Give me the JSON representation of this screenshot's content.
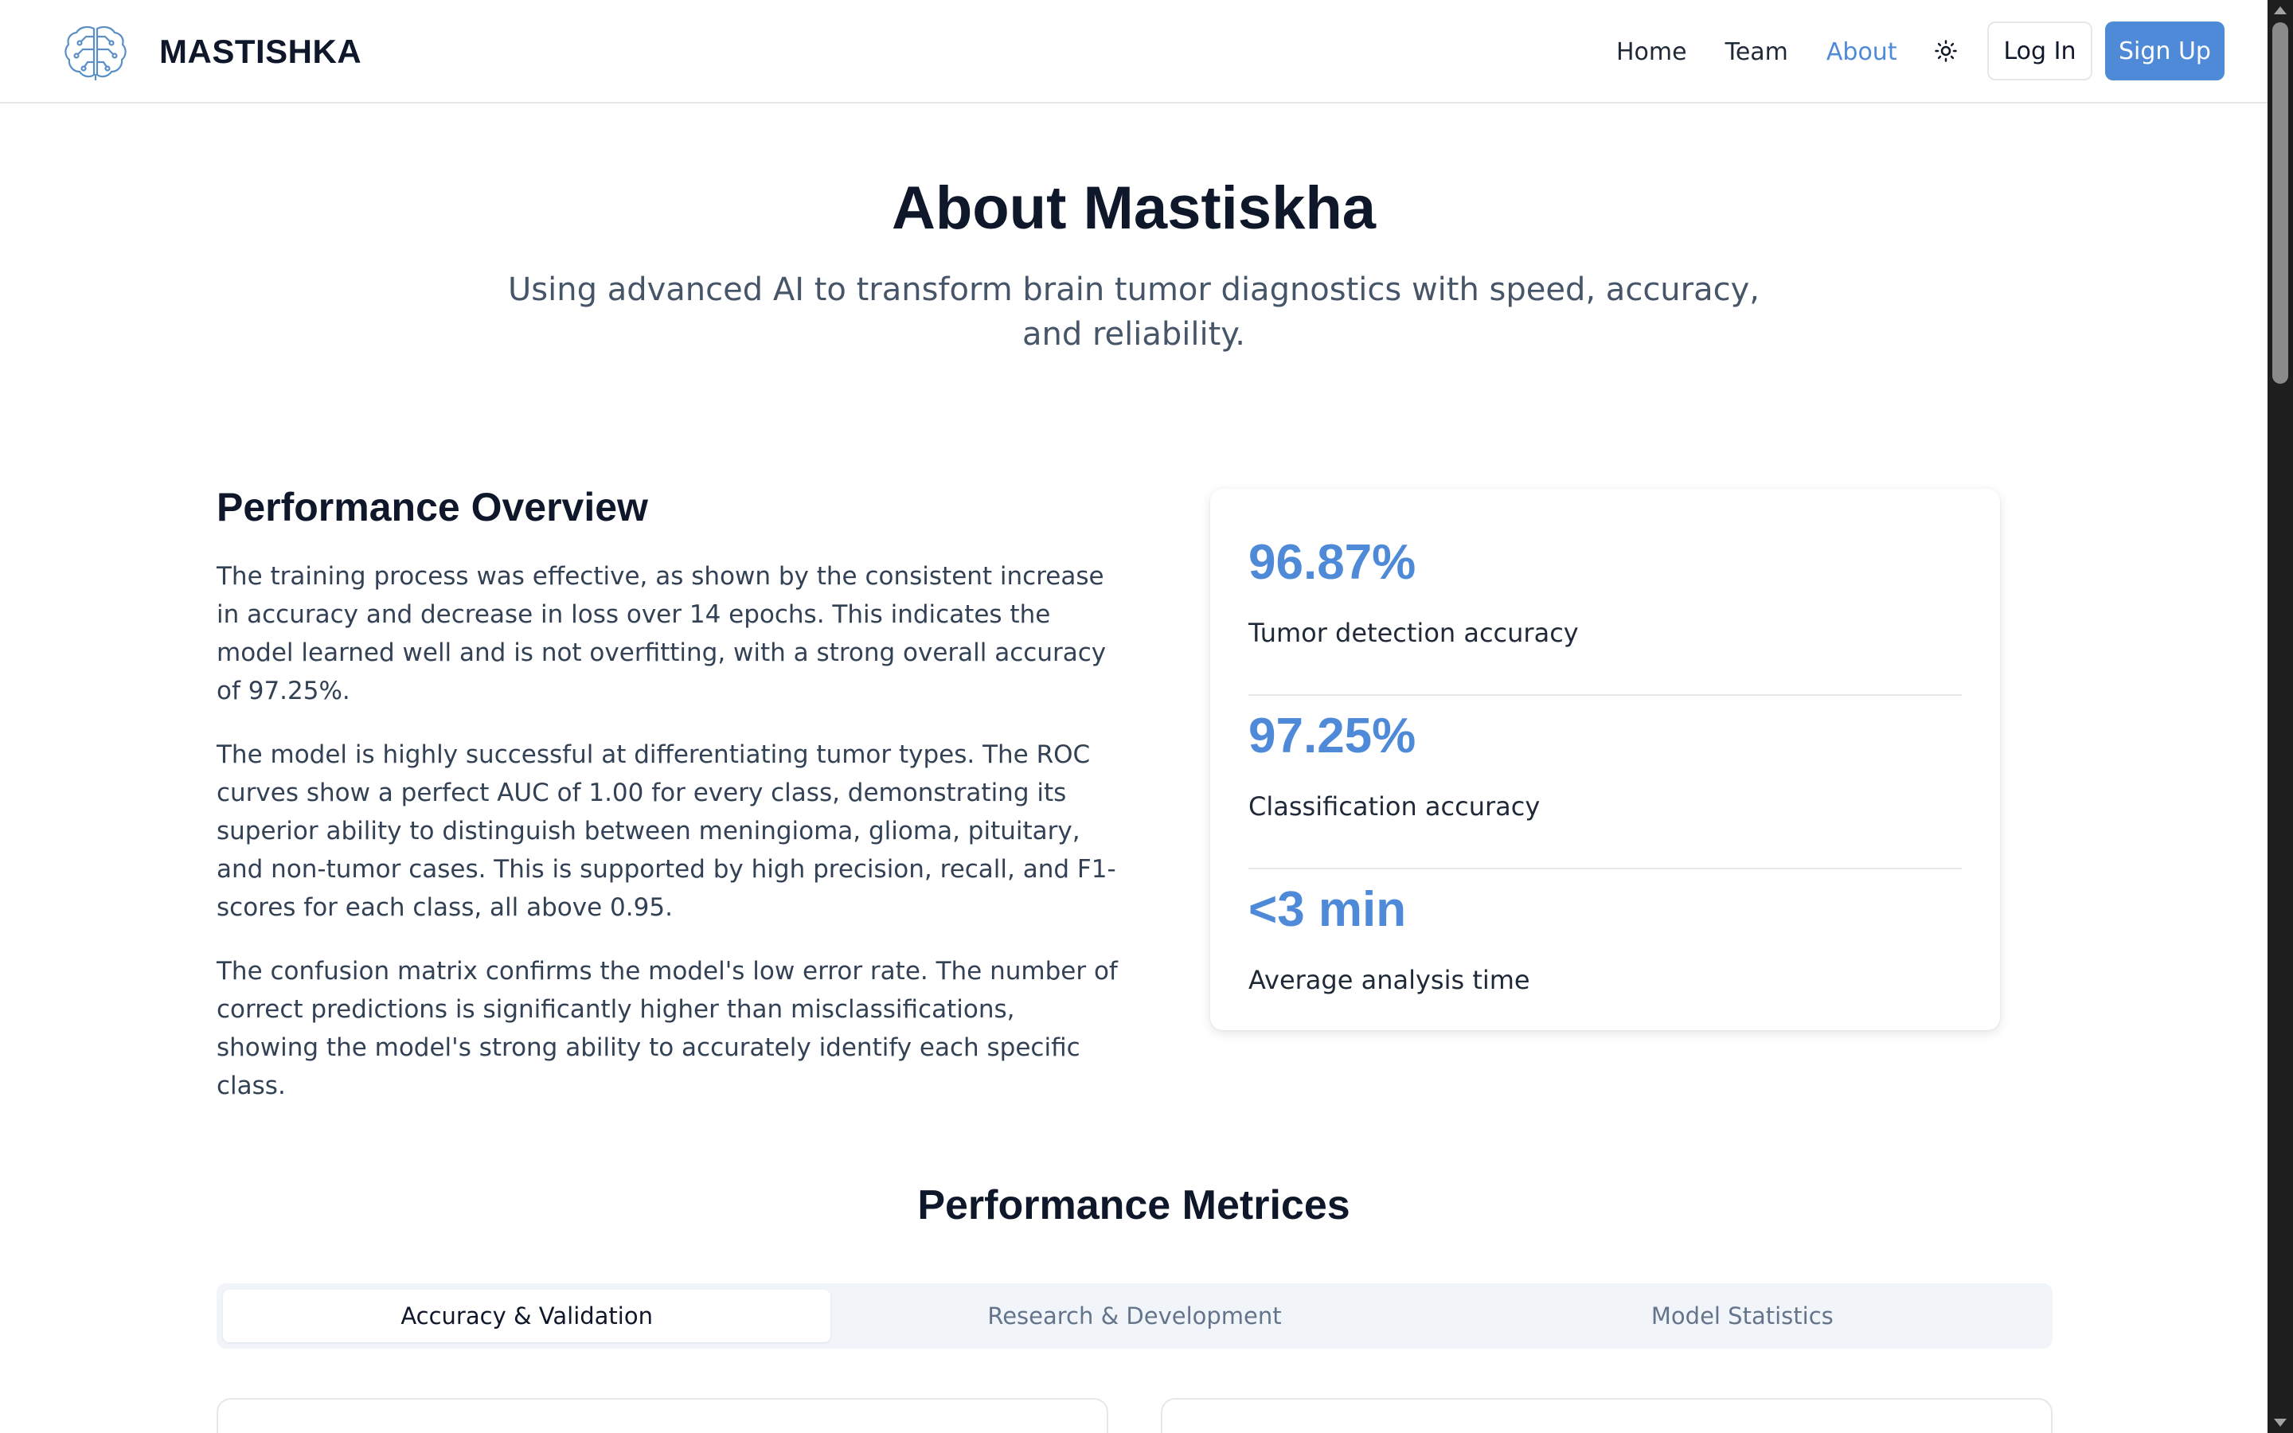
{
  "header": {
    "brand_name": "MASTISHKA",
    "logo_icon": "brain-circuit-icon",
    "nav": [
      {
        "label": "Home",
        "active": false
      },
      {
        "label": "Team",
        "active": false
      },
      {
        "label": "About",
        "active": true
      }
    ],
    "theme_icon": "sun-icon",
    "login_label": "Log In",
    "signup_label": "Sign Up"
  },
  "hero": {
    "title": "About Mastiskha",
    "subtitle": "Using advanced AI to transform brain tumor diagnostics with speed, accuracy, and reliability."
  },
  "overview": {
    "title": "Performance Overview",
    "paragraphs": [
      "The training process was effective, as shown by the consistent increase in accuracy and decrease in loss over 14 epochs. This indicates the model learned well and is not overfitting, with a strong overall accuracy of 97.25%.",
      "The model is highly successful at differentiating tumor types. The ROC curves show a perfect AUC of 1.00 for every class, demonstrating its superior ability to distinguish between meningioma, glioma, pituitary, and non-tumor cases. This is supported by high precision, recall, and F1-scores for each class, all above 0.95.",
      "The confusion matrix confirms the model's low error rate. The number of correct predictions is significantly higher than misclassifications, showing the model's strong ability to accurately identify each specific class."
    ],
    "stats": [
      {
        "value": "96.87%",
        "label": "Tumor detection accuracy"
      },
      {
        "value": "97.25%",
        "label": "Classification accuracy"
      },
      {
        "value": "<3 min",
        "label": "Average analysis time"
      }
    ]
  },
  "metrics": {
    "title": "Performance Metrices",
    "tabs": [
      {
        "label": "Accuracy & Validation",
        "active": true
      },
      {
        "label": "Research & Development",
        "active": false
      },
      {
        "label": "Model Statistics",
        "active": false
      }
    ]
  },
  "colors": {
    "accent": "#4f8ad8",
    "heading": "#0f172a",
    "body_text": "#334155",
    "muted": "#64748b",
    "border": "#e5e7eb"
  }
}
